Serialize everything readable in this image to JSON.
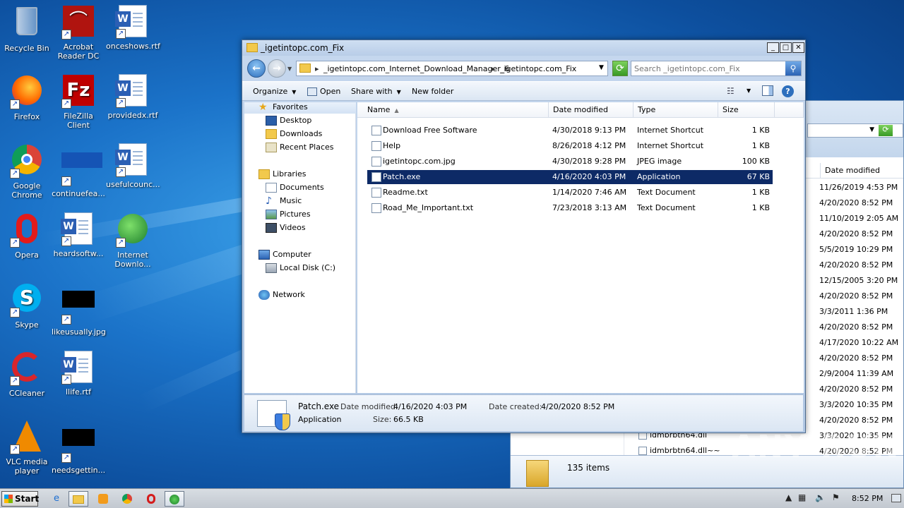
{
  "desktop": {
    "icons": [
      {
        "label": "Recycle Bin",
        "icon": "recycle-bin-icon"
      },
      {
        "label": "Acrobat Reader DC",
        "icon": "acrobat-icon"
      },
      {
        "label": "onceshows.rtf",
        "icon": "word-doc-icon"
      },
      {
        "label": "Firefox",
        "icon": "firefox-icon"
      },
      {
        "label": "FileZilla Client",
        "icon": "filezilla-icon"
      },
      {
        "label": "providedx.rtf",
        "icon": "word-doc-icon"
      },
      {
        "label": "Google Chrome",
        "icon": "chrome-icon"
      },
      {
        "label": "continuefea...",
        "icon": "blank-file-icon"
      },
      {
        "label": "usefulcounc...",
        "icon": "word-doc-icon"
      },
      {
        "label": "Opera",
        "icon": "opera-icon"
      },
      {
        "label": "heardsoftw...",
        "icon": "word-doc-icon"
      },
      {
        "label": "Internet Downlo...",
        "icon": "idm-icon"
      },
      {
        "label": "Skype",
        "icon": "skype-icon"
      },
      {
        "label": "likeusually.jpg",
        "icon": "image-file-icon"
      },
      {
        "label": "CCleaner",
        "icon": "ccleaner-icon"
      },
      {
        "label": "llife.rtf",
        "icon": "word-doc-icon"
      },
      {
        "label": "VLC media player",
        "icon": "vlc-icon"
      },
      {
        "label": "needsgettin...",
        "icon": "image-file-icon"
      }
    ]
  },
  "back_window": {
    "column": "Date modified",
    "dates": [
      "11/26/2019 4:53 PM",
      "4/20/2020 8:52 PM",
      "11/10/2019 2:05 AM",
      "4/20/2020 8:52 PM",
      "5/5/2019 10:29 PM",
      "4/20/2020 8:52 PM",
      "12/15/2005 3:20 PM",
      "4/20/2020 8:52 PM",
      "3/3/2011 1:36 PM",
      "4/20/2020 8:52 PM",
      "4/17/2020 10:22 AM",
      "4/20/2020 8:52 PM",
      "2/9/2004 11:39 AM",
      "4/20/2020 8:52 PM",
      "3/3/2020 10:35 PM",
      "4/20/2020 8:52 PM",
      "3/3/2020 10:35 PM",
      "4/20/2020 8:52 PM"
    ],
    "files": [
      "idmbrbtn64.dll",
      "idmbrbtn64.dll~~"
    ],
    "status": "135 items"
  },
  "window": {
    "title": "_igetintopc.com_Fix",
    "buttons": {
      "minimize": "_",
      "maximize": "□",
      "close": "✕"
    },
    "address": {
      "crumb1": "_igetintopc.com_Internet_Download_Manager_6",
      "crumb2": "_igetintopc.com_Fix"
    },
    "search": {
      "placeholder": "Search _igetintopc.com_Fix"
    },
    "commands": {
      "organize": "Organize",
      "open": "Open",
      "share": "Share with",
      "new_folder": "New folder"
    },
    "nav": {
      "favorites": "Favorites",
      "desktop": "Desktop",
      "downloads": "Downloads",
      "recent": "Recent Places",
      "libraries": "Libraries",
      "documents": "Documents",
      "music": "Music",
      "pictures": "Pictures",
      "videos": "Videos",
      "computer": "Computer",
      "localdisk": "Local Disk (C:)",
      "network": "Network"
    },
    "columns": {
      "name": "Name",
      "date": "Date modified",
      "type": "Type",
      "size": "Size"
    },
    "files": [
      {
        "name": "Download Free Software",
        "date": "4/30/2018 9:13 PM",
        "type": "Internet Shortcut",
        "size": "1 KB"
      },
      {
        "name": "Help",
        "date": "8/26/2018 4:12 PM",
        "type": "Internet Shortcut",
        "size": "1 KB"
      },
      {
        "name": "igetintopc.com.jpg",
        "date": "4/30/2018 9:28 PM",
        "type": "JPEG image",
        "size": "100 KB"
      },
      {
        "name": "Patch.exe",
        "date": "4/16/2020 4:03 PM",
        "type": "Application",
        "size": "67 KB"
      },
      {
        "name": "Readme.txt",
        "date": "1/14/2020 7:46 AM",
        "type": "Text Document",
        "size": "1 KB"
      },
      {
        "name": "Road_Me_Important.txt",
        "date": "7/23/2018 3:13 AM",
        "type": "Text Document",
        "size": "1 KB"
      }
    ],
    "details": {
      "name": "Patch.exe",
      "kind": "Application",
      "modified_label": "Date modified:",
      "modified": "4/16/2020 4:03 PM",
      "size_label": "Size:",
      "size": "66.5 KB",
      "created_label": "Date created:",
      "created": "4/20/2020 8:52 PM"
    }
  },
  "taskbar": {
    "start": "Start",
    "clock": "8:52 PM"
  },
  "watermark": "ANY RUN"
}
